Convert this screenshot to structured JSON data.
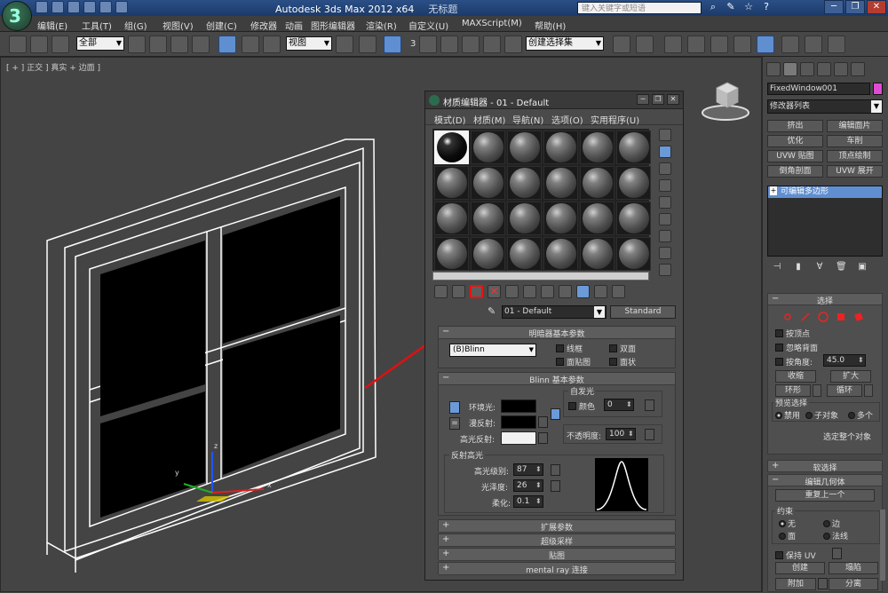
{
  "app": {
    "logo_glyph": "3",
    "title": "Autodesk 3ds Max  2012 x64",
    "document": "无标题",
    "search_placeholder": "键入关键字或短语",
    "min": "─",
    "max": "❐",
    "close": "✕"
  },
  "menu": [
    "编辑(E)",
    "工具(T)",
    "组(G)",
    "视图(V)",
    "创建(C)",
    "修改器",
    "动画",
    "图形编辑器",
    "渲染(R)",
    "自定义(U)",
    "MAXScript(M)",
    "帮助(H)"
  ],
  "toolbar": {
    "selection_filter": "全部",
    "ref_coord": "视图",
    "named_selection": "创建选择集",
    "snap_label": "3"
  },
  "viewport": {
    "label": "[ + ] 正交 ] 真实 + 边面 ]"
  },
  "material_editor": {
    "title": "材质编辑器 - 01 - Default",
    "menus": [
      "模式(D)",
      "材质(M)",
      "导航(N)",
      "选项(O)",
      "实用程序(U)"
    ],
    "material_name": "01 - Default",
    "material_type": "Standard",
    "shader_rollout": "明暗器基本参数",
    "shader": "(B)Blinn",
    "shader_options": [
      "线框",
      "双面",
      "面贴图",
      "面状"
    ],
    "blinn_rollout": "Blinn 基本参数",
    "self_illum_group": "自发光",
    "color_label": "颜色",
    "self_illum_value": "0",
    "ambient": "环境光:",
    "diffuse": "漫反射:",
    "specular": "高光反射:",
    "opacity_label": "不透明度:",
    "opacity_value": "100",
    "specular_group": "反射高光",
    "spec_level_label": "高光级别:",
    "spec_level": "87",
    "glossiness_label": "光泽度:",
    "glossiness": "26",
    "soften_label": "柔化:",
    "soften": "0.1",
    "collapsed_rollouts": [
      "扩展参数",
      "超级采样",
      "贴图",
      "mental ray 连接"
    ]
  },
  "command_panel": {
    "object_name": "FixedWindow001",
    "modifier_list": "修改器列表",
    "modifier_buttons": [
      "挤出",
      "编辑面片",
      "优化",
      "车削",
      "UVW 贴图",
      "顶点绘制",
      "倒角剖面",
      "UVW 展开"
    ],
    "stack_item": "可编辑多边形",
    "selection_rollout": "选择",
    "by_vertex": "按顶点",
    "ignore_backfacing": "忽略背面",
    "by_angle": "按角度:",
    "angle_value": "45.0",
    "shrink": "收缩",
    "grow": "扩大",
    "ring": "环形",
    "loop": "循环",
    "preview_selection": "预览选择",
    "preview_options": [
      "禁用",
      "子对象",
      "多个"
    ],
    "whole_object": "选定整个对象",
    "soft_selection": "软选择",
    "edit_geometry": "编辑几何体",
    "repeat_last": "重复上一个",
    "constraints": "约束",
    "constraint_options": [
      "无",
      "边",
      "面",
      "法线"
    ],
    "preserve_uv": "保持 UV",
    "create": "创建",
    "collapse": "塌陷",
    "attach": "附加",
    "detach": "分离"
  },
  "colors": {
    "ambient_swatch": "#000000",
    "diffuse_swatch": "#000000",
    "specular_swatch": "#f2f2f2",
    "annotation_red": "#e01010",
    "object_color": "#e04bd6"
  }
}
